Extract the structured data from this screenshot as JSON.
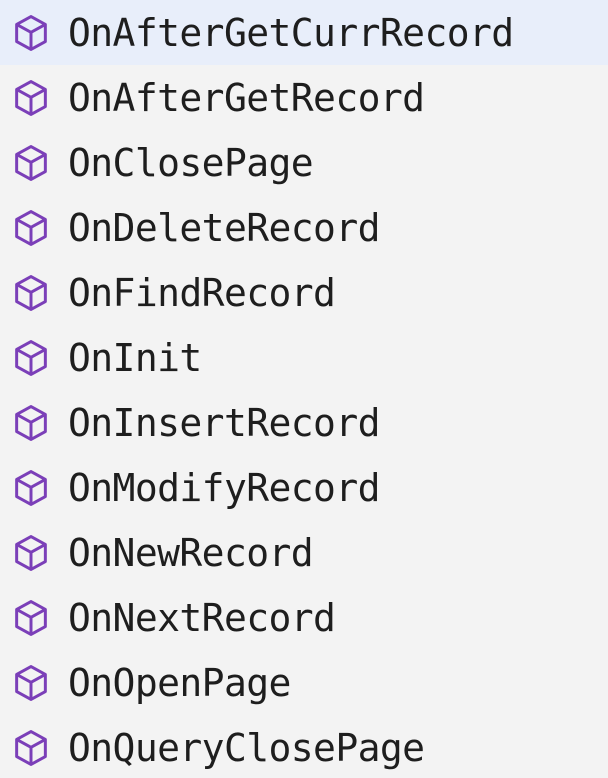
{
  "suggestions": {
    "selected_index": 0,
    "icon_name": "method-cube-icon",
    "icon_color": "#7b3fb8",
    "selected_background": "#e8eefa",
    "items": [
      {
        "label": "OnAfterGetCurrRecord"
      },
      {
        "label": "OnAfterGetRecord"
      },
      {
        "label": "OnClosePage"
      },
      {
        "label": "OnDeleteRecord"
      },
      {
        "label": "OnFindRecord"
      },
      {
        "label": "OnInit"
      },
      {
        "label": "OnInsertRecord"
      },
      {
        "label": "OnModifyRecord"
      },
      {
        "label": "OnNewRecord"
      },
      {
        "label": "OnNextRecord"
      },
      {
        "label": "OnOpenPage"
      },
      {
        "label": "OnQueryClosePage"
      }
    ]
  }
}
